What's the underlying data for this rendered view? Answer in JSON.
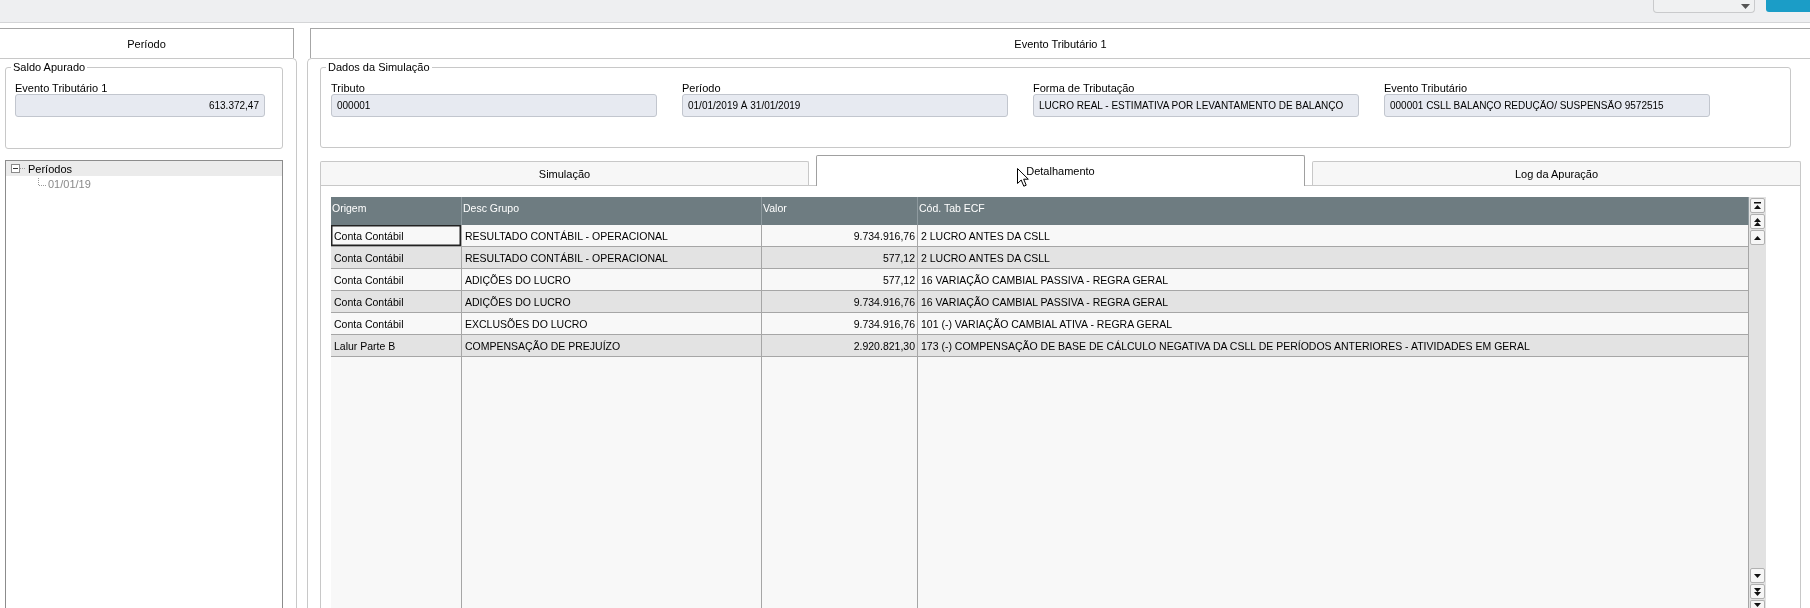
{
  "left_panel": {
    "title": "Período",
    "saldo_apurado": {
      "legend": "Saldo Apurado",
      "label": "Evento Tributário 1",
      "value": "613.372,47"
    },
    "tree": [
      {
        "label": "Períodos",
        "selected": true,
        "disabled": false,
        "expanded": true,
        "children": [
          {
            "label": "01/01/19",
            "selected": false,
            "disabled": true
          }
        ]
      }
    ]
  },
  "right_panel": {
    "title": "Evento Tributário 1",
    "simulation_data": {
      "legend": "Dados da Simulação",
      "fields": [
        {
          "label": "Tributo",
          "value": "000001"
        },
        {
          "label": "Período",
          "value": "01/01/2019 À 31/01/2019"
        },
        {
          "label": "Forma de Tributação",
          "value": "LUCRO REAL - ESTIMATIVA POR LEVANTAMENTO DE BALANÇO"
        },
        {
          "label": "Evento Tributário",
          "value": "000001 CSLL BALANÇO REDUÇÃO/ SUSPENSÃO 9572515"
        }
      ]
    },
    "tabs": [
      {
        "label": "Simulação",
        "selected": false
      },
      {
        "label": "Detalhamento",
        "selected": true
      },
      {
        "label": "Log da Apuração",
        "selected": false
      }
    ],
    "table": {
      "columns": [
        {
          "label": "Origem",
          "kind": "text"
        },
        {
          "label": "Desc Grupo",
          "kind": "text"
        },
        {
          "label": "Valor",
          "kind": "number"
        },
        {
          "label": "Cód. Tab ECF",
          "kind": "text"
        }
      ],
      "rows": [
        {
          "cells": [
            "Conta Contábil",
            "RESULTADO CONTÁBIL - OPERACIONAL",
            "9.734.916,76",
            "2 LUCRO ANTES DA CSLL"
          ],
          "focused": true
        },
        {
          "cells": [
            "Conta Contábil",
            "RESULTADO CONTÁBIL - OPERACIONAL",
            "577,12",
            "2 LUCRO ANTES DA CSLL"
          ],
          "focused": false
        },
        {
          "cells": [
            "Conta Contábil",
            "ADIÇÕES DO LUCRO",
            "577,12",
            "16 VARIAÇÃO CAMBIAL PASSIVA - REGRA GERAL"
          ],
          "focused": false
        },
        {
          "cells": [
            "Conta Contábil",
            "ADIÇÕES DO LUCRO",
            "9.734.916,76",
            "16 VARIAÇÃO CAMBIAL PASSIVA - REGRA GERAL"
          ],
          "focused": false
        },
        {
          "cells": [
            "Conta Contábil",
            "EXCLUSÕES DO LUCRO",
            "9.734.916,76",
            "101 (-) VARIAÇÃO CAMBIAL ATIVA - REGRA GERAL"
          ],
          "focused": false
        },
        {
          "cells": [
            "Lalur Parte B",
            "COMPENSAÇÃO DE PREJUÍZO",
            "2.920.821,30",
            "173 (-) COMPENSAÇÃO DE BASE DE CÁLCULO NEGATIVA DA CSLL DE PERÍODOS ANTERIORES - ATIVIDADES EM GERAL"
          ],
          "focused": false
        }
      ]
    }
  }
}
